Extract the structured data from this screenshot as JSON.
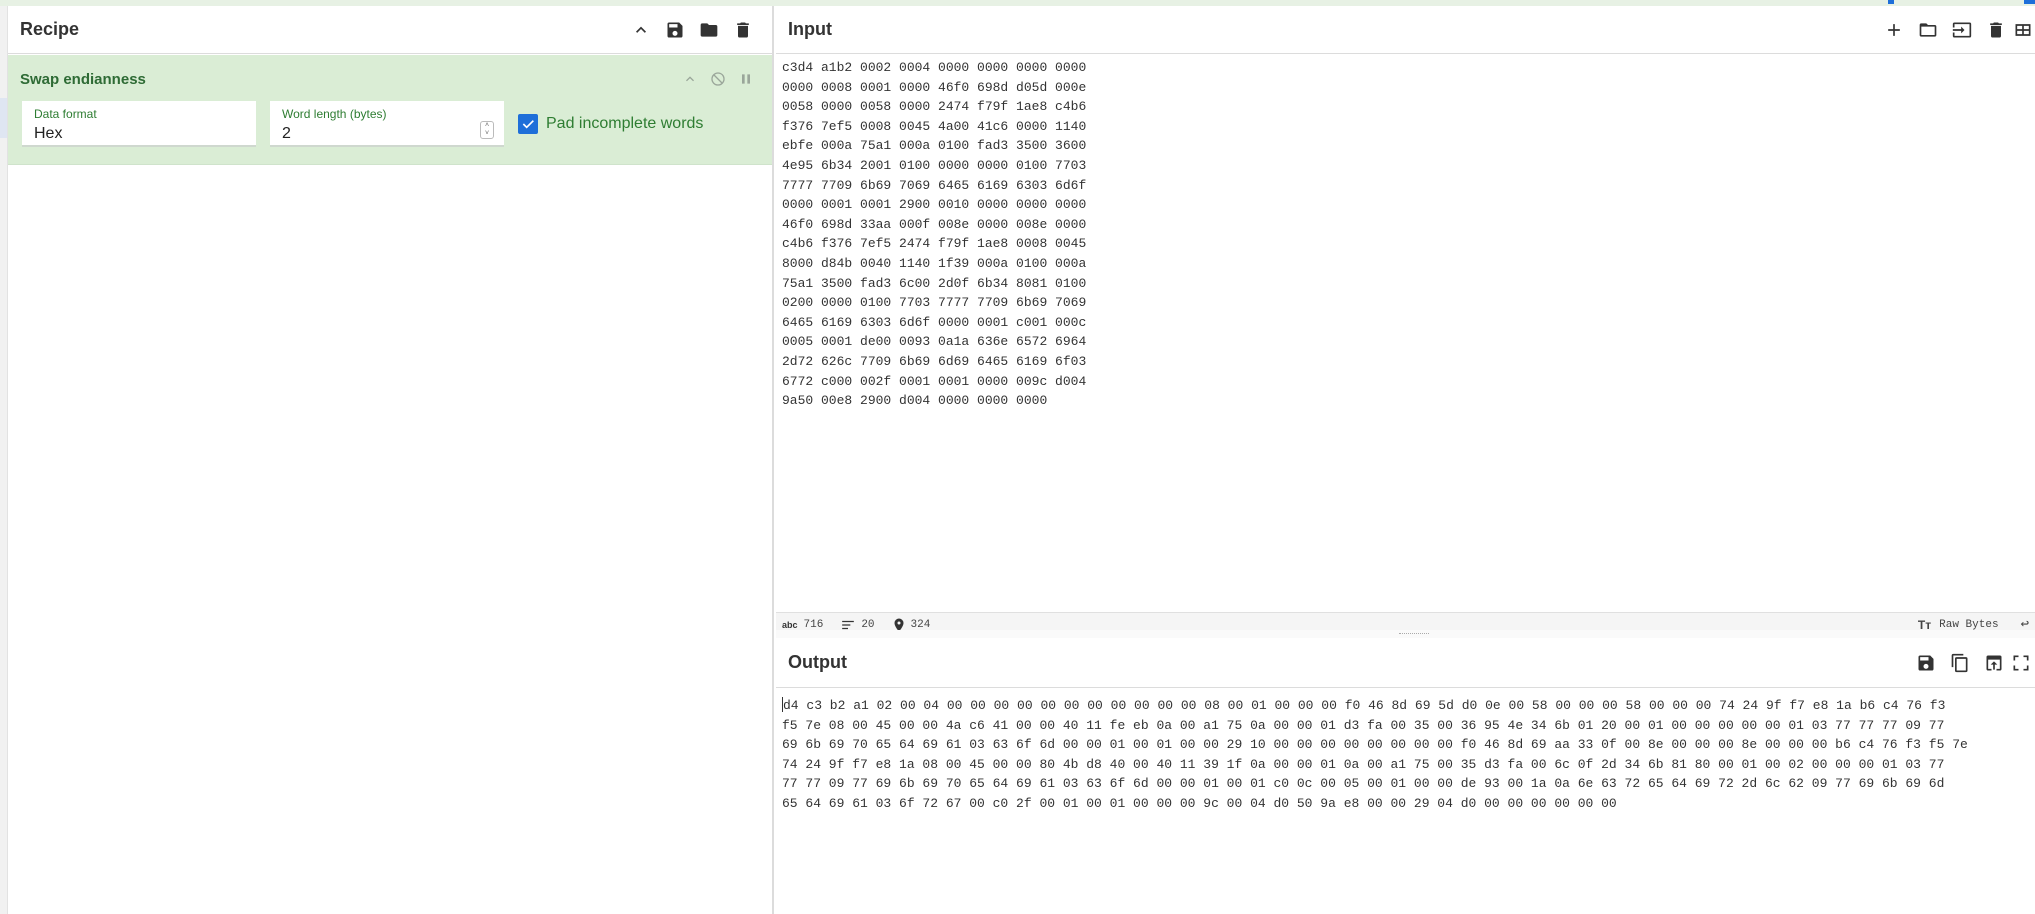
{
  "colors": {
    "accent": "#1e6fd9",
    "op_bg": "#daedd5",
    "op_text": "#2e6b35"
  },
  "recipe": {
    "title": "Recipe",
    "icons": [
      "chevron-up-icon",
      "save-icon",
      "folder-icon",
      "trash-icon"
    ],
    "operation": {
      "name": "Swap endianness",
      "data_format_label": "Data format",
      "data_format_value": "Hex",
      "word_length_label": "Word length (bytes)",
      "word_length_value": "2",
      "pad_label": "Pad incomplete words",
      "pad_checked": true
    }
  },
  "input": {
    "title": "Input",
    "icons": [
      "plus-icon",
      "folder-icon",
      "import-icon",
      "trash-icon",
      "layout-icon"
    ],
    "text": "c3d4 a1b2 0002 0004 0000 0000 0000 0000\n0000 0008 0001 0000 46f0 698d d05d 000e\n0058 0000 0058 0000 2474 f79f 1ae8 c4b6\nf376 7ef5 0008 0045 4a00 41c6 0000 1140\nebfe 000a 75a1 000a 0100 fad3 3500 3600\n4e95 6b34 2001 0100 0000 0000 0100 7703\n7777 7709 6b69 7069 6465 6169 6303 6d6f\n0000 0001 0001 2900 0010 0000 0000 0000\n46f0 698d 33aa 000f 008e 0000 008e 0000\nc4b6 f376 7ef5 2474 f79f 1ae8 0008 0045\n8000 d84b 0040 1140 1f39 000a 0100 000a\n75a1 3500 fad3 6c00 2d0f 6b34 8081 0100\n0200 0000 0100 7703 7777 7709 6b69 7069\n6465 6169 6303 6d6f 0000 0001 c001 000c\n0005 0001 de00 0093 0a1a 636e 6572 6964\n2d72 626c 7709 6b69 6d69 6465 6169 6f03\n6772 c000 002f 0001 0001 0000 009c d004\n9a50 00e8 2900 d004 0000 0000 0000",
    "status": {
      "length_icon": "abc",
      "length": "716",
      "lines": "20",
      "position": "324",
      "encoding": "Raw Bytes"
    }
  },
  "output": {
    "title": "Output",
    "icons": [
      "save-icon",
      "copy-icon",
      "replace-input-icon",
      "maximize-icon"
    ],
    "text": "d4 c3 b2 a1 02 00 04 00 00 00 00 00 00 00 00 00 00 00 08 00 01 00 00 00 f0 46 8d 69 5d d0 0e 00 58 00 00 00 58 00 00 00 74 24 9f f7 e8 1a b6 c4 76 f3\nf5 7e 08 00 45 00 00 4a c6 41 00 00 40 11 fe eb 0a 00 a1 75 0a 00 00 01 d3 fa 00 35 00 36 95 4e 34 6b 01 20 00 01 00 00 00 00 00 01 03 77 77 77 09 77\n69 6b 69 70 65 64 69 61 03 63 6f 6d 00 00 01 00 01 00 00 29 10 00 00 00 00 00 00 00 00 f0 46 8d 69 aa 33 0f 00 8e 00 00 00 8e 00 00 00 b6 c4 76 f3 f5 7e\n74 24 9f f7 e8 1a 08 00 45 00 00 80 4b d8 40 00 40 11 39 1f 0a 00 00 01 0a 00 a1 75 00 35 d3 fa 00 6c 0f 2d 34 6b 81 80 00 01 00 02 00 00 00 01 03 77\n77 77 09 77 69 6b 69 70 65 64 69 61 03 63 6f 6d 00 00 01 00 01 c0 0c 00 05 00 01 00 00 de 93 00 1a 0a 6e 63 72 65 64 69 72 2d 6c 62 09 77 69 6b 69 6d\n65 64 69 61 03 6f 72 67 00 c0 2f 00 01 00 01 00 00 00 9c 00 04 d0 50 9a e8 00 00 29 04 d0 00 00 00 00 00 00"
  }
}
